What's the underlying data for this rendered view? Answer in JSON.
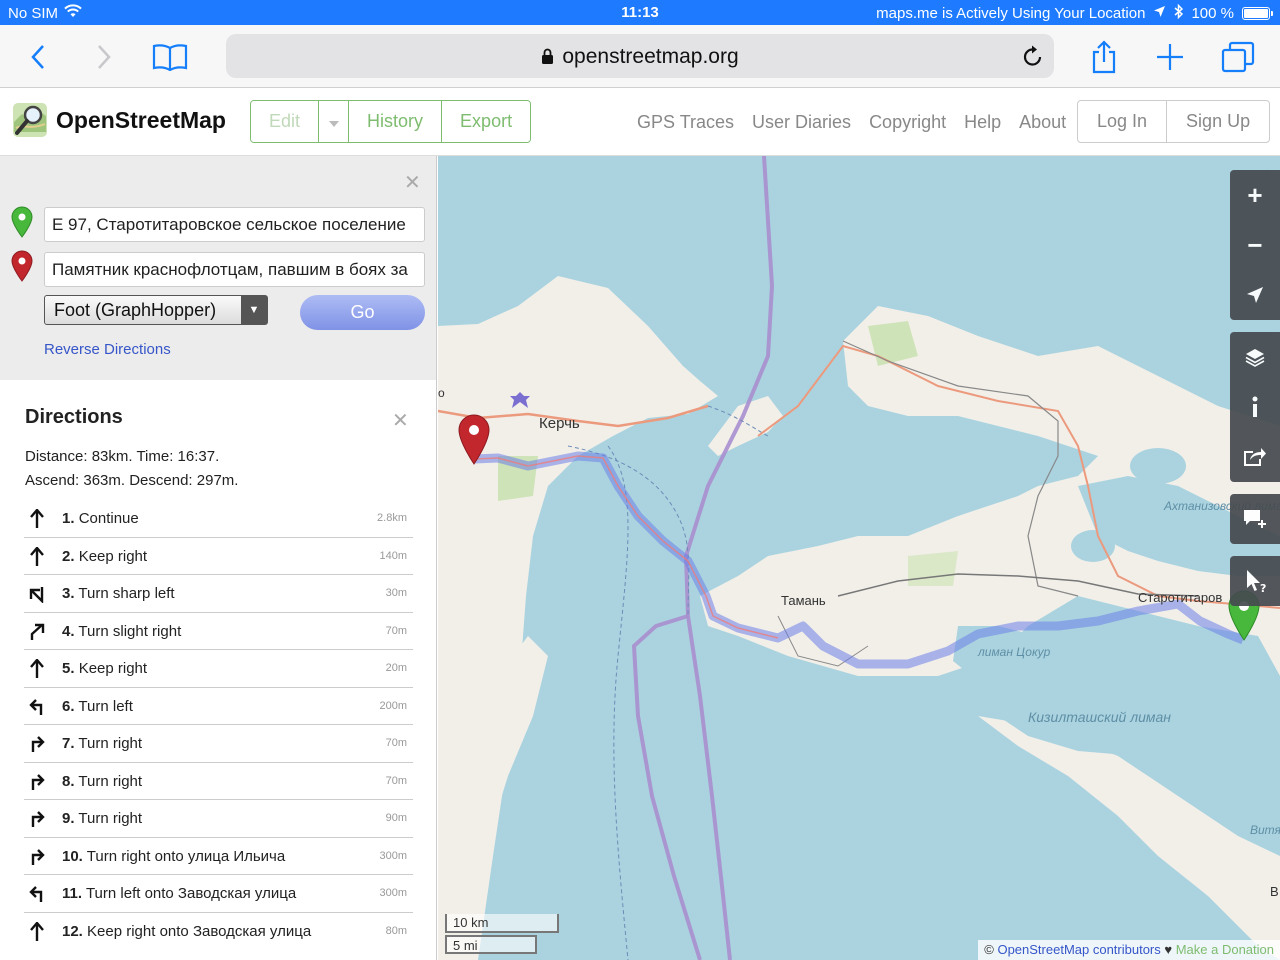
{
  "status_bar": {
    "carrier": "No SIM",
    "time": "11:13",
    "location_notice": "maps.me is Actively Using Your Location",
    "battery": "100 %",
    "battery_level": 1.0
  },
  "browser": {
    "url": "openstreetmap.org"
  },
  "header": {
    "site_name": "OpenStreetMap",
    "edit_label": "Edit",
    "history_label": "History",
    "export_label": "Export",
    "nav": [
      "GPS Traces",
      "User Diaries",
      "Copyright",
      "Help",
      "About"
    ],
    "login_label": "Log In",
    "signup_label": "Sign Up"
  },
  "route_form": {
    "from_value": "E 97, Старотитаровское сельское поселение",
    "to_value": "Памятник краснофлотцам, павшим в боях за",
    "engine": "Foot (GraphHopper)",
    "go_label": "Go",
    "reverse_label": "Reverse Directions"
  },
  "directions": {
    "title": "Directions",
    "summary_line1": "Distance: 83km. Time: 16:37.",
    "summary_line2": "Ascend: 363m. Descend: 297m.",
    "steps": [
      {
        "num": "1.",
        "text": "Continue",
        "dist": "2.8km",
        "icon": "straight-icon"
      },
      {
        "num": "2.",
        "text": "Keep right",
        "dist": "140m",
        "icon": "straight-icon"
      },
      {
        "num": "3.",
        "text": "Turn sharp left",
        "dist": "30m",
        "icon": "sharp-left-icon"
      },
      {
        "num": "4.",
        "text": "Turn slight right",
        "dist": "70m",
        "icon": "slight-right-icon"
      },
      {
        "num": "5.",
        "text": "Keep right",
        "dist": "20m",
        "icon": "straight-icon"
      },
      {
        "num": "6.",
        "text": "Turn left",
        "dist": "200m",
        "icon": "turn-left-icon"
      },
      {
        "num": "7.",
        "text": "Turn right",
        "dist": "70m",
        "icon": "turn-right-icon"
      },
      {
        "num": "8.",
        "text": "Turn right",
        "dist": "70m",
        "icon": "turn-right-icon"
      },
      {
        "num": "9.",
        "text": "Turn right",
        "dist": "90m",
        "icon": "turn-right-icon"
      },
      {
        "num": "10.",
        "text": "Turn right onto улица Ильича",
        "dist": "300m",
        "icon": "turn-right-icon"
      },
      {
        "num": "11.",
        "text": "Turn left onto Заводская улица",
        "dist": "300m",
        "icon": "turn-left-icon"
      },
      {
        "num": "12.",
        "text": "Keep right onto Заводская улица",
        "dist": "80m",
        "icon": "straight-icon"
      }
    ]
  },
  "map": {
    "labels": {
      "kerch": "Керчь",
      "taman": "Тамань",
      "starotitarovskaya": "Старотитаров",
      "o": "о",
      "v": "В"
    },
    "water_labels": {
      "akhtanizovsky": "Ахтанизовский лиман",
      "tsokur": "лиман Цокур",
      "kiziltashsky": "Кизилташский лиман",
      "vityaz": "Витязе лим"
    },
    "scale_km": "10 km",
    "scale_mi": "5 mi",
    "attribution_prefix": "© ",
    "attribution_link": "OpenStreetMap contributors",
    "attribution_heart": " ♥ ",
    "attribution_donate": "Make a Donation"
  },
  "colors": {
    "osm_green": "#7ebc6f",
    "route_blue": "#6b7fe8",
    "water": "#aad3df",
    "land": "#f2efe9"
  }
}
